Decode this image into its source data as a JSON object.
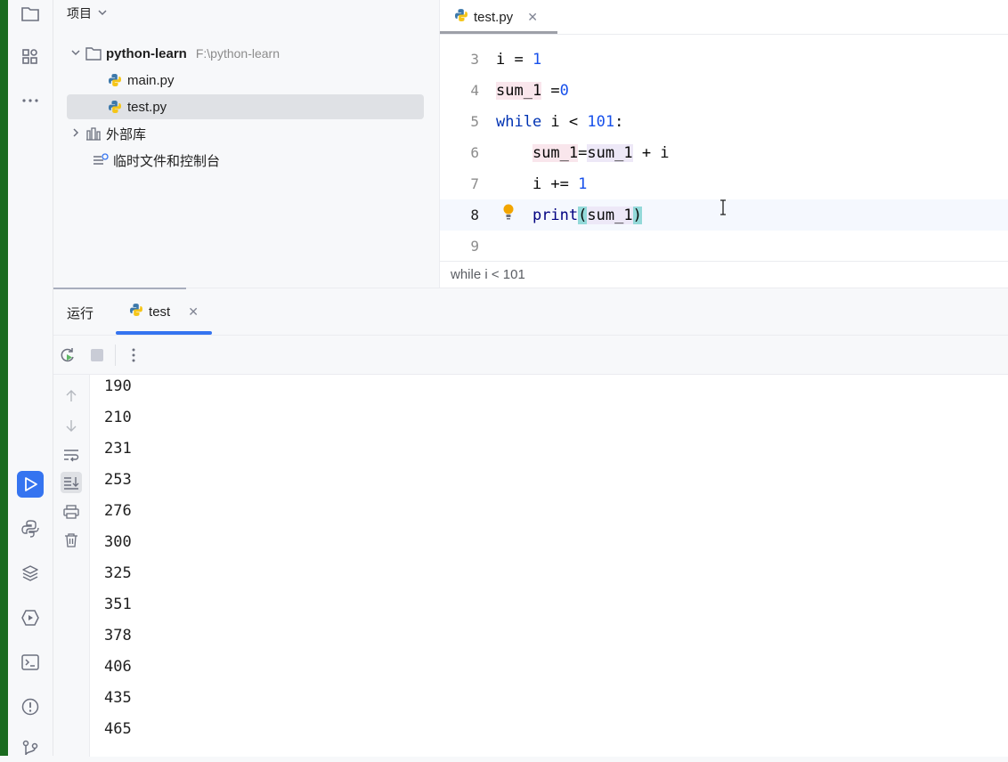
{
  "project_panel": {
    "title": "项目",
    "root": {
      "name": "python-learn",
      "path": "F:\\python-learn"
    },
    "files": [
      "main.py",
      "test.py"
    ],
    "external_libs": "外部库",
    "scratches": "临时文件和控制台"
  },
  "editor": {
    "tab": "test.py",
    "lines": [
      {
        "n": "3"
      },
      {
        "n": "4"
      },
      {
        "n": "5"
      },
      {
        "n": "6"
      },
      {
        "n": "7"
      },
      {
        "n": "8"
      },
      {
        "n": "9"
      }
    ],
    "code": {
      "l3_var": "i",
      "l3_op": " = ",
      "l3_num": "1",
      "l4_var": "sum_1",
      "l4_op": " =",
      "l4_num": "0",
      "l5_kw": "while",
      "l5_mid": " i < ",
      "l5_num": "101",
      "l5_end": ":",
      "l6_a": "sum_1",
      "l6_eq": "=",
      "l6_b": "sum_1",
      "l6_rest": " + i",
      "l7_a": "i += ",
      "l7_num": "1",
      "l8_fn": "print",
      "l8_open": "(",
      "l8_arg": "sum_1",
      "l8_close": ")"
    },
    "breadcrumb": "while i < 101"
  },
  "run_panel": {
    "label": "运行",
    "tab": "test",
    "output": [
      "190",
      "210",
      "231",
      "253",
      "276",
      "300",
      "325",
      "351",
      "378",
      "406",
      "435",
      "465"
    ]
  },
  "colors": {
    "accent": "#3574f0",
    "keyword": "#0033b3",
    "number": "#1750eb"
  }
}
